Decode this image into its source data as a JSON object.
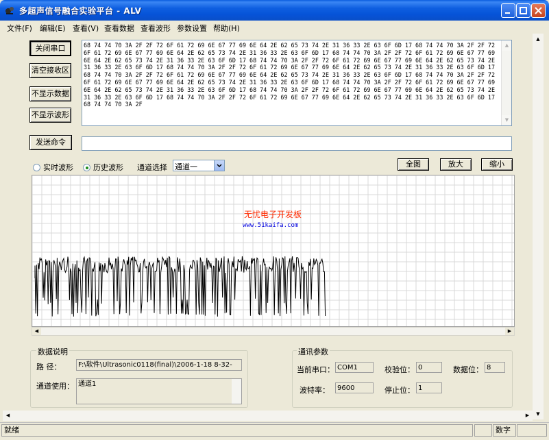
{
  "window": {
    "title": "多超声信号融合实验平台 - ALV"
  },
  "menu": [
    "文件(F)",
    "编辑(E)",
    "查看(V)",
    "查看数据",
    "查看波形",
    "参数设置",
    "帮助(H)"
  ],
  "buttons": {
    "close_port": "关闭串口",
    "clear_recv": "清空接收区",
    "hide_data": "不显示数据",
    "hide_wave": "不显示波形",
    "send_cmd": "发送命令",
    "full_view": "全图",
    "zoom_in": "放大",
    "zoom_out": "缩小"
  },
  "receive_area": {
    "text": "68 74 74 70 3A 2F 2F 72 6F 61 72 69 6E 67 77 69 6E 64 2E 62 65 73 74 2E 31 36 33 2E 63 6F 6D 17 68 74 74 70 3A 2F 2F 72 6F 61 72 69 6E 67 77 69 6E 64 2E 62 65 73 74 2E 31 36 33 2E 63 6F 6D 17 68 74 74 70 3A 2F 2F 72 6F 61 72 69 6E 67 77 69 6E 64 2E 62 65 73 74 2E 31 36 33 2E 63 6F 6D 17 68 74 74 70 3A 2F 2F 72 6F 61 72 69 6E 67 77 69 6E 64 2E 62 65 73 74 2E 31 36 33 2E 63 6F 6D 17 68 74 74 70 3A 2F 2F 72 6F 61 72 69 6E 67 77 69 6E 64 2E 62 65 73 74 2E 31 36 33 2E 63 6F 6D 17 68 74 74 70 3A 2F 2F 72 6F 61 72 69 6E 67 77 69 6E 64 2E 62 65 73 74 2E 31 36 33 2E 63 6F 6D 17 68 74 74 70 3A 2F 2F 72 6F 61 72 69 6E 67 77 69 6E 64 2E 62 65 73 74 2E 31 36 33 2E 63 6F 6D 17 68 74 74 70 3A 2F 2F 72 6F 61 72 69 6E 67 77 69 6E 64 2E 62 65 73 74 2E 31 36 33 2E 63 6F 6D 17 68 74 74 70 3A 2F 2F 72 6F 61 72 69 6E 67 77 69 6E 64 2E 62 65 73 74 2E 31 36 33 2E 63 6F 6D 17 68 74 74 70 3A 2F 2F 72 6F 61 72 69 6E 67 77 69 6E 64 2E 62 65 73 74 2E 31 36 33 2E 63 6F 6D 17 68 74 74 70 3A 2F"
  },
  "command_input": "",
  "wave_mode": {
    "realtime": "实时波形",
    "history": "历史波形",
    "selected": "history"
  },
  "channel_select": {
    "label": "通道选择",
    "value": "通道一"
  },
  "watermark": {
    "line1": "无忧电子开发板",
    "line2": "www.51kaifa.com"
  },
  "data_desc": {
    "title": "数据说明",
    "path_label": "路    径：",
    "path_value": "F:\\软件\\Ultrasonic0118(final)\\2006-1-18 8-32-",
    "channel_label": "通道使用：",
    "channel_value": "通道1"
  },
  "comm_params": {
    "title": "通讯参数",
    "port_label": "当前串口：",
    "port_value": "COM1",
    "parity_label": "校验位：",
    "parity_value": "0",
    "databits_label": "数据位：",
    "databits_value": "8",
    "baud_label": "波特率：",
    "baud_value": "9600",
    "stopbits_label": "停止位：",
    "stopbits_value": "1"
  },
  "status": {
    "left": "就绪",
    "num": "数字"
  },
  "colors": {
    "titlebar": "#0a5ddf",
    "watermark_red": "#ff2a00",
    "watermark_blue": "#0000e0",
    "grid": "#d8d8d8"
  }
}
